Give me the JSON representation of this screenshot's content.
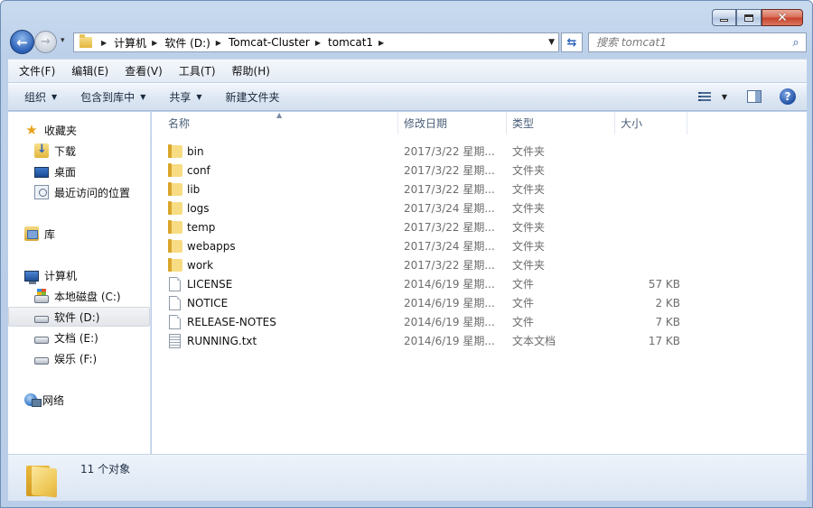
{
  "window": {
    "caption_buttons": {
      "minimize": "—",
      "maximize": "□",
      "close": "✕"
    }
  },
  "nav": {
    "back_glyph": "←",
    "forward_glyph": "→",
    "history_glyph": "▾"
  },
  "address": {
    "crumbs": [
      "计算机",
      "软件 (D:)",
      "Tomcat-Cluster",
      "tomcat1"
    ],
    "separator": "▶",
    "dropdown_glyph": "▼",
    "refresh_glyph": "⇆"
  },
  "search": {
    "placeholder": "搜索 tomcat1",
    "icon": "search-icon"
  },
  "menu": [
    "文件(F)",
    "编辑(E)",
    "查看(V)",
    "工具(T)",
    "帮助(H)"
  ],
  "commands": [
    {
      "label": "组织",
      "dropdown": true
    },
    {
      "label": "包含到库中",
      "dropdown": true
    },
    {
      "label": "共享",
      "dropdown": true
    },
    {
      "label": "新建文件夹",
      "dropdown": false
    }
  ],
  "command_right": {
    "view_caret": "▼",
    "help_glyph": "?"
  },
  "navpane": {
    "favorites": {
      "label": "收藏夹",
      "icon": "star-icon"
    },
    "favorite_items": [
      {
        "label": "下载",
        "icon": "download-icon"
      },
      {
        "label": "桌面",
        "icon": "desktop-icon"
      },
      {
        "label": "最近访问的位置",
        "icon": "recent-places-icon"
      }
    ],
    "library": {
      "label": "库",
      "icon": "library-icon"
    },
    "computer": {
      "label": "计算机",
      "icon": "computer-icon"
    },
    "drives": [
      {
        "label": "本地磁盘 (C:)",
        "icon": "system-drive-icon",
        "selected": false
      },
      {
        "label": "软件 (D:)",
        "icon": "drive-icon",
        "selected": true
      },
      {
        "label": "文档 (E:)",
        "icon": "drive-icon",
        "selected": false
      },
      {
        "label": "娱乐 (F:)",
        "icon": "drive-icon",
        "selected": false
      }
    ],
    "network": {
      "label": "网络",
      "icon": "network-icon"
    }
  },
  "columns": {
    "name": "名称",
    "date": "修改日期",
    "type": "类型",
    "size": "大小",
    "sort_glyph": "▲"
  },
  "files": [
    {
      "name": "bin",
      "date": "2017/3/22 星期...",
      "type": "文件夹",
      "size": "",
      "icon": "folder-icon"
    },
    {
      "name": "conf",
      "date": "2017/3/22 星期...",
      "type": "文件夹",
      "size": "",
      "icon": "folder-icon"
    },
    {
      "name": "lib",
      "date": "2017/3/22 星期...",
      "type": "文件夹",
      "size": "",
      "icon": "folder-icon"
    },
    {
      "name": "logs",
      "date": "2017/3/24 星期...",
      "type": "文件夹",
      "size": "",
      "icon": "folder-icon"
    },
    {
      "name": "temp",
      "date": "2017/3/22 星期...",
      "type": "文件夹",
      "size": "",
      "icon": "folder-icon"
    },
    {
      "name": "webapps",
      "date": "2017/3/24 星期...",
      "type": "文件夹",
      "size": "",
      "icon": "folder-icon"
    },
    {
      "name": "work",
      "date": "2017/3/22 星期...",
      "type": "文件夹",
      "size": "",
      "icon": "folder-icon"
    },
    {
      "name": "LICENSE",
      "date": "2014/6/19 星期...",
      "type": "文件",
      "size": "57 KB",
      "icon": "file-icon"
    },
    {
      "name": "NOTICE",
      "date": "2014/6/19 星期...",
      "type": "文件",
      "size": "2 KB",
      "icon": "file-icon"
    },
    {
      "name": "RELEASE-NOTES",
      "date": "2014/6/19 星期...",
      "type": "文件",
      "size": "7 KB",
      "icon": "file-icon"
    },
    {
      "name": "RUNNING.txt",
      "date": "2014/6/19 星期...",
      "type": "文本文档",
      "size": "17 KB",
      "icon": "text-file-icon"
    }
  ],
  "details": {
    "count_text": "11 个对象",
    "icon": "folder-icon"
  }
}
